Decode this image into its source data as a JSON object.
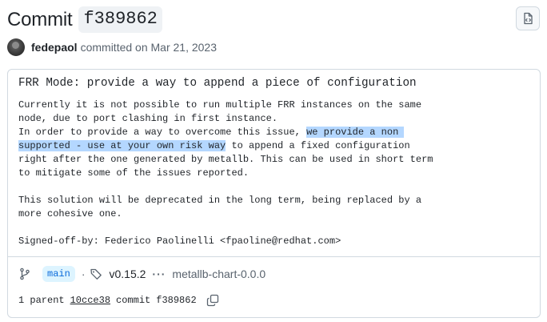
{
  "header": {
    "title_prefix": "Commit",
    "sha": "f389862",
    "browse_icon": "file-code-icon"
  },
  "author_line": {
    "author": "fedepaol",
    "committed_text": "committed on Mar 21, 2023"
  },
  "message": {
    "title": "FRR Mode: provide a way to append a piece of configuration",
    "body_line1": "Currently it is not possible to run multiple FRR instances on the same",
    "body_line2": "node, due to port clashing in first instance.",
    "body_line3_pre": "In order to provide a way to overcome this issue, ",
    "body_line3_hl": "we provide a non ",
    "body_line4_hl": "supported - use at your own risk way",
    "body_line4_post": " to append a fixed configuration",
    "body_line5": "right after the one generated by metallb. This can be used in short term",
    "body_line6": "to mitigate some of the issues reported.",
    "body_line7": "",
    "body_line8": "This solution will be deprecated in the long term, being replaced by a",
    "body_line9": "more cohesive one.",
    "body_line10": "",
    "body_line11": "Signed-off-by: Federico Paolinelli <fpaoline@redhat.com>"
  },
  "refs": {
    "branch": "main",
    "separator": "·",
    "tag": "v0.15.2",
    "more": "···",
    "tag2": "metallb-chart-0.0.0"
  },
  "parent": {
    "label": "1 parent",
    "parent_sha": "10cce38",
    "commit_label": "commit",
    "commit_sha": "f389862"
  },
  "colors": {
    "highlight": "#b4d7ff",
    "branch_bg": "#ddf4ff",
    "branch_fg": "#0969da",
    "border": "#d1d9e0"
  }
}
